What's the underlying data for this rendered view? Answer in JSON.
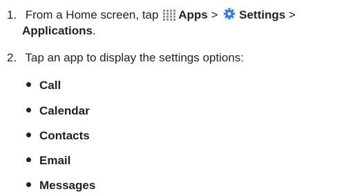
{
  "steps": [
    {
      "number": "1.",
      "text_from": "From a Home screen, tap",
      "apps_label": "Apps",
      "sep1": ">",
      "settings_label": "Settings",
      "sep2": ">",
      "applications_label": "Applications",
      "period": "."
    },
    {
      "number": "2.",
      "text": "Tap an app to display the settings options:"
    }
  ],
  "options": [
    "Call",
    "Calendar",
    "Contacts",
    "Email",
    "Messages"
  ],
  "colors": {
    "text": "#222222",
    "apps_icon": "#8a8a8a",
    "settings_icon": "#3a78c8"
  },
  "icons": {
    "apps": "apps-grid-icon",
    "settings": "settings-gear-icon"
  }
}
